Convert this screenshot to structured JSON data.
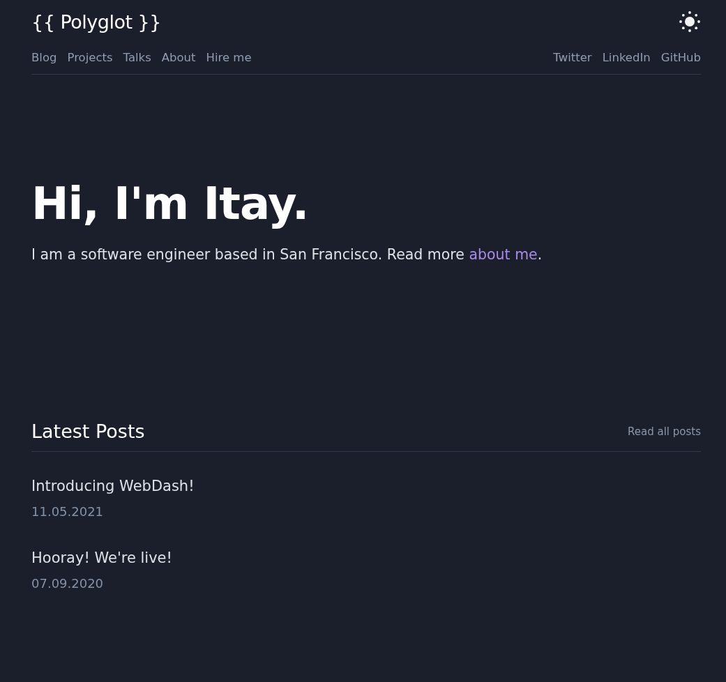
{
  "header": {
    "logo": "{{ Polyglot }}",
    "theme_toggle": {
      "kind": "sun"
    }
  },
  "nav": {
    "left": [
      "Blog",
      "Projects",
      "Talks",
      "About",
      "Hire me"
    ],
    "right": [
      "Twitter",
      "LinkedIn",
      "GitHub"
    ]
  },
  "hero": {
    "title": "Hi, I'm Itay.",
    "intro_before": "I am a software engineer based in San Francisco. Read more ",
    "intro_link": "about me",
    "intro_after": "."
  },
  "latest_posts": {
    "title": "Latest Posts",
    "read_all": "Read all posts",
    "posts": [
      {
        "title": "Introducing WebDash!",
        "date": "11.05.2021"
      },
      {
        "title": "Hooray! We're live!",
        "date": "07.09.2020"
      }
    ]
  }
}
